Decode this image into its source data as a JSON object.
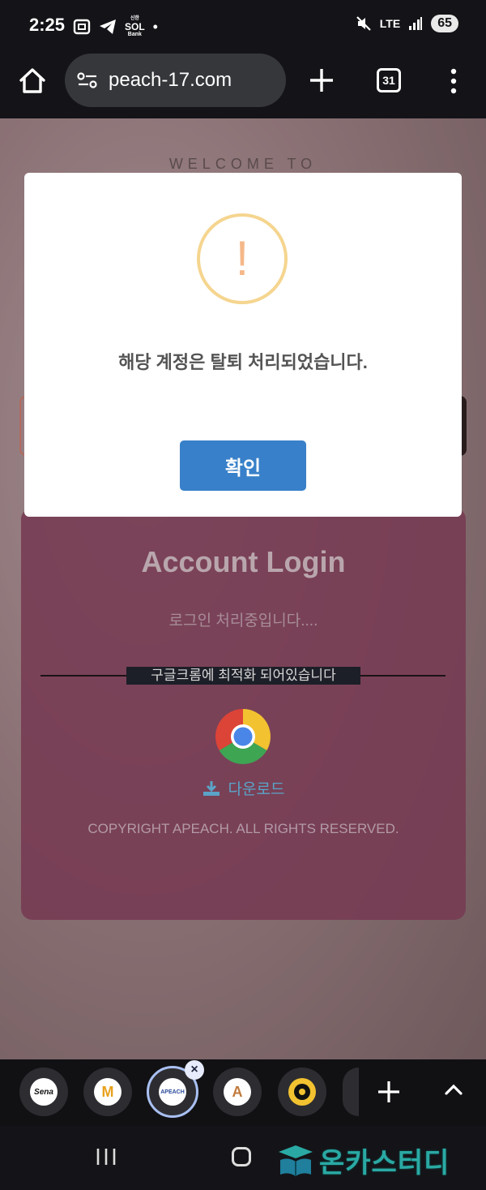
{
  "status": {
    "time": "2:25",
    "sol_line1": "신한",
    "sol_line2": "SOL",
    "sol_line3": "Bank",
    "dot": "•",
    "lte": "LTE",
    "battery": "65"
  },
  "browser": {
    "url": "peach-17.com",
    "tab_count": "31"
  },
  "page": {
    "welcome": "WELCOME TO",
    "login_title": "Account Login",
    "processing": "로그인 처리중입니다....",
    "chrome_notice": "구글크롬에 최적화 되어있습니다",
    "download": "다운로드",
    "copyright": "COPYRIGHT APEACH. ALL RIGHTS RESERVED."
  },
  "modal": {
    "icon_glyph": "!",
    "message": "해당 계정은 탈퇴 처리되었습니다.",
    "confirm": "확인"
  },
  "tabs": [
    {
      "label": "Sena",
      "icon": "sena-favicon"
    },
    {
      "label": "M",
      "icon": "m-logo-favicon"
    },
    {
      "label": "APEACH",
      "icon": "apeach-favicon",
      "active": true,
      "close": "×"
    },
    {
      "label": "A",
      "icon": "a-logo-favicon"
    },
    {
      "label": "",
      "icon": "ball-favicon"
    }
  ],
  "watermark": "온카스터디",
  "colors": {
    "modal_button": "#3880c9",
    "warning_ring": "#f5d58f",
    "login_card": "#763a52",
    "download": "#5ba3c8"
  }
}
